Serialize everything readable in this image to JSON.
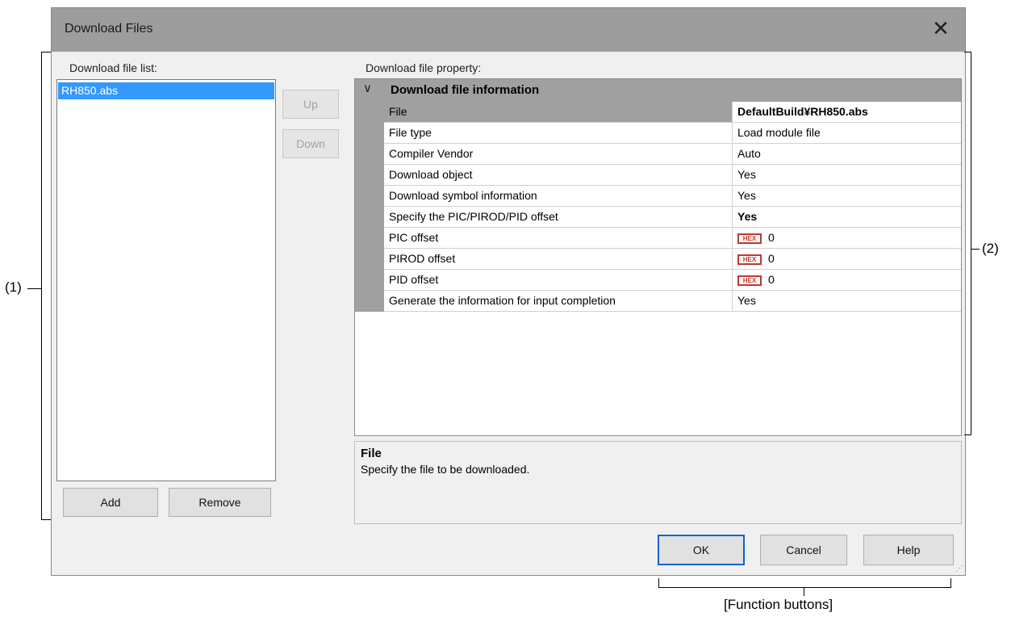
{
  "dialog": {
    "title": "Download Files",
    "close_glyph": "✕"
  },
  "left": {
    "list_label": "Download file list:",
    "items": [
      "RH850.abs"
    ],
    "up_label": "Up",
    "down_label": "Down",
    "add_label": "Add",
    "remove_label": "Remove"
  },
  "property": {
    "label": "Download file property:",
    "category": "Download file information",
    "rows": [
      {
        "name": "File",
        "value": "DefaultBuild¥RH850.abs",
        "bold": true
      },
      {
        "name": "File type",
        "value": "Load module file"
      },
      {
        "name": "Compiler Vendor",
        "value": "Auto"
      },
      {
        "name": "Download object",
        "value": "Yes"
      },
      {
        "name": "Download symbol information",
        "value": "Yes"
      },
      {
        "name": "Specify the PIC/PIROD/PID offset",
        "value": "Yes",
        "bold": true
      },
      {
        "name": "PIC offset",
        "value": "0",
        "hex": true
      },
      {
        "name": "PIROD offset",
        "value": "0",
        "hex": true
      },
      {
        "name": "PID offset",
        "value": "0",
        "hex": true
      },
      {
        "name": "Generate the information for input completion",
        "value": "Yes"
      }
    ],
    "hex_badge": "HEX"
  },
  "description": {
    "title": "File",
    "text": "Specify the file to be downloaded."
  },
  "buttons": {
    "ok": "OK",
    "cancel": "Cancel",
    "help": "Help"
  },
  "annotations": {
    "left": "(1)",
    "right": "(2)",
    "bottom": "[Function buttons]"
  },
  "colors": {
    "titlebar": "#9d9d9d",
    "selection": "#3399ff",
    "category": "#a0a0a0",
    "hex_badge": "#c0392b"
  }
}
